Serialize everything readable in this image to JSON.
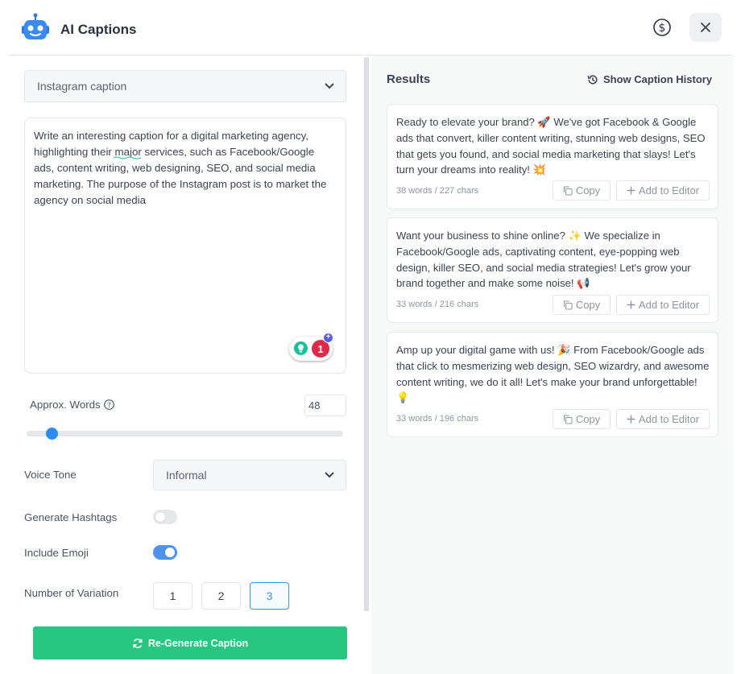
{
  "header": {
    "title": "AI Captions",
    "icons": {
      "logo": "robot-icon",
      "pricing": "dollar-circle-icon",
      "close": "close-icon"
    }
  },
  "form": {
    "caption_type": {
      "selected": "Instagram caption"
    },
    "prompt": "Write an interesting caption for a digital marketing agency, highlighting their major services, such as Facebook/Google ads, content writing, web designing, SEO, and social media marketing. The purpose of the Instagram post is to market the agency on social media",
    "grammar_badge_count": "1",
    "approx_words": {
      "label": "Approx. Words",
      "value": "48",
      "slider_fraction": 0.08
    },
    "voice_tone": {
      "label": "Voice Tone",
      "selected": "Informal"
    },
    "generate_hashtags": {
      "label": "Generate Hashtags",
      "enabled": false
    },
    "include_emoji": {
      "label": "Include Emoji",
      "enabled": true
    },
    "variations": {
      "label": "Number of Variation",
      "options": [
        "1",
        "2",
        "3"
      ],
      "selected": "3"
    },
    "regenerate_label": "Re-Generate Caption"
  },
  "results": {
    "title": "Results",
    "history_label": "Show Caption History",
    "copy_label": "Copy",
    "add_label": "Add to Editor",
    "items": [
      {
        "text": "Ready to elevate your brand? 🚀 We've got Facebook & Google ads that convert, killer content writing, stunning web designs, SEO that gets you found, and social media marketing that slays! Let's turn your dreams into reality! 💥",
        "meta": "38 words / 227 chars"
      },
      {
        "text": "Want your business to shine online? ✨ We specialize in Facebook/Google ads, captivating content, eye-popping web design, killer SEO, and social media strategies! Let's grow your brand together and make some noise! 📢",
        "meta": "33 words / 216 chars"
      },
      {
        "text": "Amp up your digital game with us! 🎉 From Facebook/Google ads that click to mesmerizing web design, SEO wizardry, and awesome content writing, we do it all! Let's make your brand unforgettable! 💡",
        "meta": "33 words / 196 chars"
      }
    ]
  },
  "colors": {
    "accent": "#2e8cf0",
    "primary_button": "#27c681",
    "selected_variation": "#3a94e8"
  }
}
